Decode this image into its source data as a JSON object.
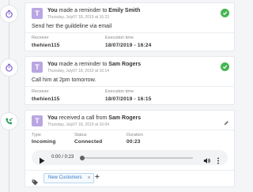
{
  "activities": [
    {
      "type": "reminder",
      "avatar": "T",
      "prefix": "You",
      "text": " made a reminder to ",
      "target": "Emily Smith",
      "time": "Thursday, July07 18, 2019 at 16:23",
      "note": "Send her the guildeline via email",
      "receiver_label": "Receiver",
      "receiver": "thehien115",
      "exec_label": "Execution time",
      "exec_time": "18/07/2019 - 16:24",
      "status_icon": "check-circle-icon"
    },
    {
      "type": "reminder",
      "avatar": "T",
      "prefix": "You",
      "text": " made a reminder to ",
      "target": "Sam Rogers",
      "time": "Thursday, July07 18, 2019 at 16:14",
      "note": "Call him at 2pm tomorrow.",
      "receiver_label": "Receiver",
      "receiver": "thehien115",
      "exec_label": "Execution time",
      "exec_time": "18/07/2019 - 16:15",
      "status_icon": "check-circle-icon"
    },
    {
      "type": "call",
      "avatar": "T",
      "prefix": "You",
      "text": " received a call from ",
      "target": "Sam Rogers",
      "time": "Thursday, July07 18, 2019 at 16:04",
      "type_label": "Type",
      "call_type": "Incoming",
      "status_label": "Status",
      "call_status": "Connected",
      "duration_label": "Duration",
      "duration": "00:23",
      "player_time": "0:00 / 0:23",
      "progress": 0,
      "tags": [
        "New Customers"
      ],
      "tag_remove": "×",
      "tag_add": "+"
    }
  ],
  "colors": {
    "timeline_icon": "#7b5fc9",
    "call_icon": "#2e9e5b",
    "done": "#47b552",
    "avatar": "#b9a6e3",
    "tag_text": "#3478c6"
  }
}
